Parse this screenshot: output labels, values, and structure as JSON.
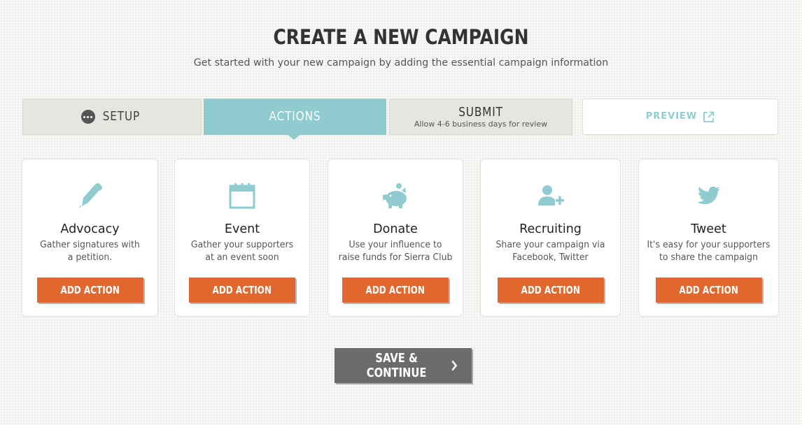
{
  "header": {
    "title": "CREATE A NEW CAMPAIGN",
    "subtitle": "Get started with your new campaign by adding the essential campaign information"
  },
  "steps": {
    "setup": {
      "label": "SETUP",
      "icon": "ellipsis-circle-icon"
    },
    "actions": {
      "label": "ACTIONS",
      "state": "active"
    },
    "submit": {
      "label": "SUBMIT",
      "note": "Allow 4-6 business days for review"
    },
    "preview": {
      "label": "PREVIEW",
      "icon": "external-link-icon"
    }
  },
  "cards": [
    {
      "icon": "pen-icon",
      "title": "Advocacy",
      "line1": "Gather signatures with",
      "line2": "a petition.",
      "button": "ADD ACTION"
    },
    {
      "icon": "calendar-icon",
      "title": "Event",
      "line1": "Gather your supporters",
      "line2": "at an event soon",
      "button": "ADD ACTION"
    },
    {
      "icon": "piggy-bank-icon",
      "title": "Donate",
      "line1": "Use your influence to",
      "line2": "raise funds for Sierra Club",
      "button": "ADD ACTION"
    },
    {
      "icon": "add-user-icon",
      "title": "Recruiting",
      "line1": "Share your campaign via",
      "line2": "Facebook, Twitter",
      "button": "ADD ACTION"
    },
    {
      "icon": "twitter-bird-icon",
      "title": "Tweet",
      "line1": "It's easy for your supporters",
      "line2": "to share the campaign",
      "button": "ADD ACTION"
    }
  ],
  "footer": {
    "save_label": "SAVE & CONTINUE",
    "save_icon": "chevron-right-icon"
  },
  "colors": {
    "accent": "#8fcbcf",
    "button_orange": "#e0682e",
    "save_gray": "#6b6b6b"
  }
}
